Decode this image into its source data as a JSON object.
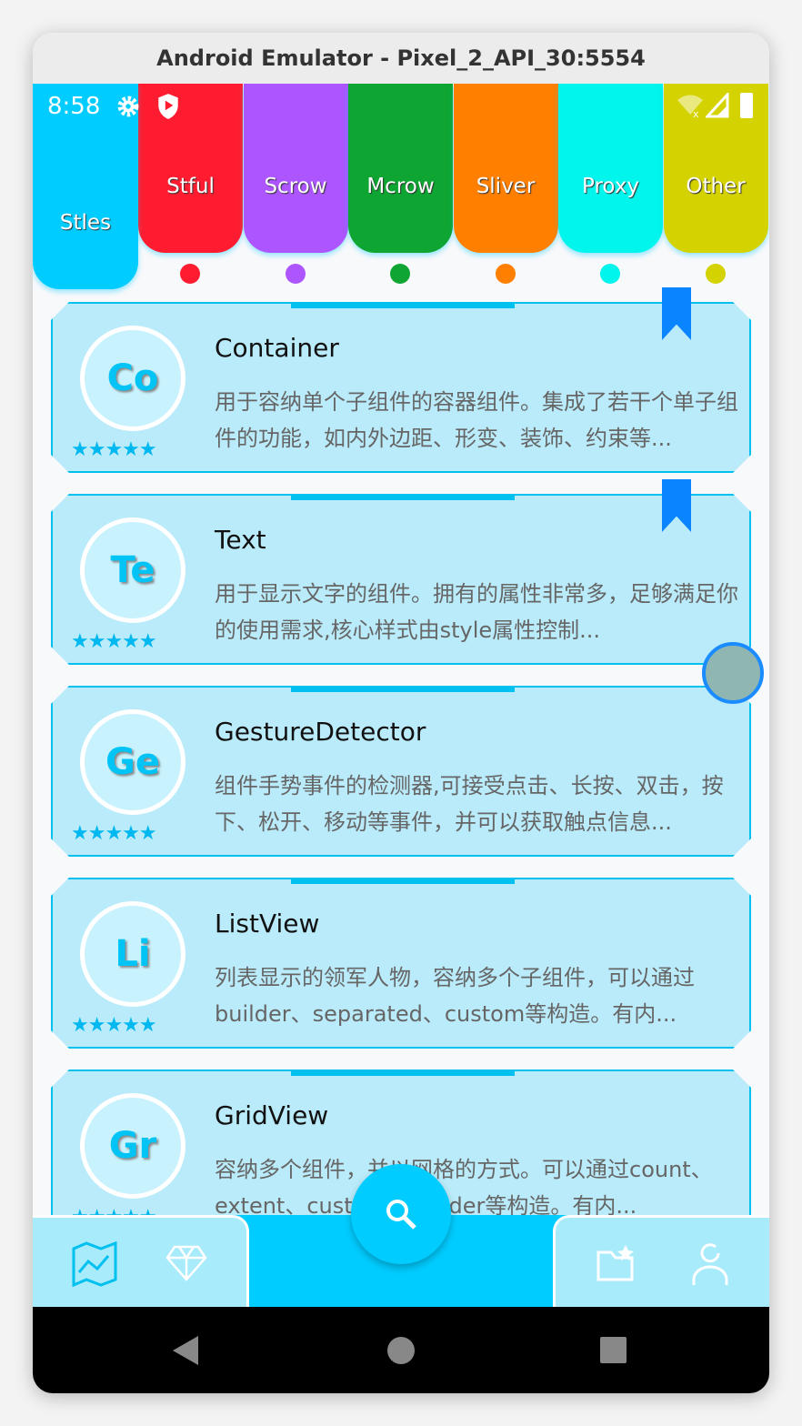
{
  "window": {
    "title": "Android Emulator - Pixel_2_API_30:5554"
  },
  "status": {
    "time": "8:58",
    "icons": [
      "gear-icon",
      "shield-play-icon",
      "wifi-off-icon",
      "signal-icon",
      "battery-icon"
    ]
  },
  "tabs": [
    {
      "label": "Stles",
      "color": "#00ccff",
      "active": true
    },
    {
      "label": "Stful",
      "color": "#ff1c30"
    },
    {
      "label": "Scrow",
      "color": "#ad55ff"
    },
    {
      "label": "Mcrow",
      "color": "#0ea532"
    },
    {
      "label": "Sliver",
      "color": "#ff7f00"
    },
    {
      "label": "Proxy",
      "color": "#00f5ec"
    },
    {
      "label": "Other",
      "color": "#d4d200"
    }
  ],
  "cards": [
    {
      "abbr": "Co",
      "title": "Container",
      "desc": "用于容纳单个子组件的容器组件。集成了若干个单子组件的功能，如内外边距、形变、装饰、约束等...",
      "stars": "★★★★★",
      "bookmarked": true
    },
    {
      "abbr": "Te",
      "title": "Text",
      "desc": "用于显示文字的组件。拥有的属性非常多，足够满足你的使用需求,核心样式由style属性控制...",
      "stars": "★★★★★",
      "bookmarked": true
    },
    {
      "abbr": "Ge",
      "title": "GestureDetector",
      "desc": "组件手势事件的检测器,可接受点击、长按、双击，按下、松开、移动等事件，并可以获取触点信息...",
      "stars": "★★★★★"
    },
    {
      "abbr": "Li",
      "title": "ListView",
      "desc": "列表显示的领军人物，容纳多个子组件，可以通过builder、separated、custom等构造。有内...",
      "stars": "★★★★★"
    },
    {
      "abbr": "Gr",
      "title": "GridView",
      "desc": "容纳多个组件，并以网格的方式。可以通过count、extent、custom、builder等构造。有内...",
      "stars": "★★★★★"
    }
  ],
  "bottom_nav": {
    "left": [
      "map-chart-icon",
      "diamond-icon"
    ],
    "center": "search-icon",
    "right": [
      "folder-star-icon",
      "person-icon"
    ]
  }
}
